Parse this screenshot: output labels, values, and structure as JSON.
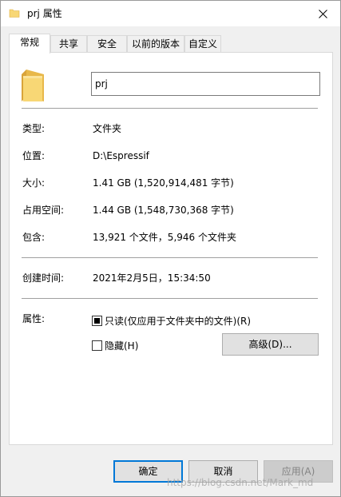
{
  "window": {
    "title": "prj 属性"
  },
  "tabs": [
    {
      "label": "常规",
      "active": true
    },
    {
      "label": "共享",
      "active": false
    },
    {
      "label": "安全",
      "active": false
    },
    {
      "label": "以前的版本",
      "active": false
    },
    {
      "label": "自定义",
      "active": false
    }
  ],
  "general": {
    "name_value": "prj",
    "type_label": "类型:",
    "type_value": "文件夹",
    "location_label": "位置:",
    "location_value": "D:\\Espressif",
    "size_label": "大小:",
    "size_value": "1.41 GB (1,520,914,481 字节)",
    "disk_label": "占用空间:",
    "disk_value": "1.44 GB (1,548,730,368 字节)",
    "contains_label": "包含:",
    "contains_value": "13,921 个文件，5,946 个文件夹",
    "created_label": "创建时间:",
    "created_value": "2021年2月5日，15:34:50",
    "attributes_label": "属性:",
    "readonly_label": "只读(仅应用于文件夹中的文件)(R)",
    "readonly_checked": true,
    "hidden_label": "隐藏(H)",
    "hidden_checked": false,
    "advanced_label": "高级(D)..."
  },
  "footer": {
    "ok": "确定",
    "cancel": "取消",
    "apply": "应用(A)"
  },
  "watermark": "https://blog.csdn.net/Mark_md",
  "colors": {
    "folder": "#f8d775",
    "folder_dark": "#e8b84a",
    "accent": "#0078d7"
  }
}
